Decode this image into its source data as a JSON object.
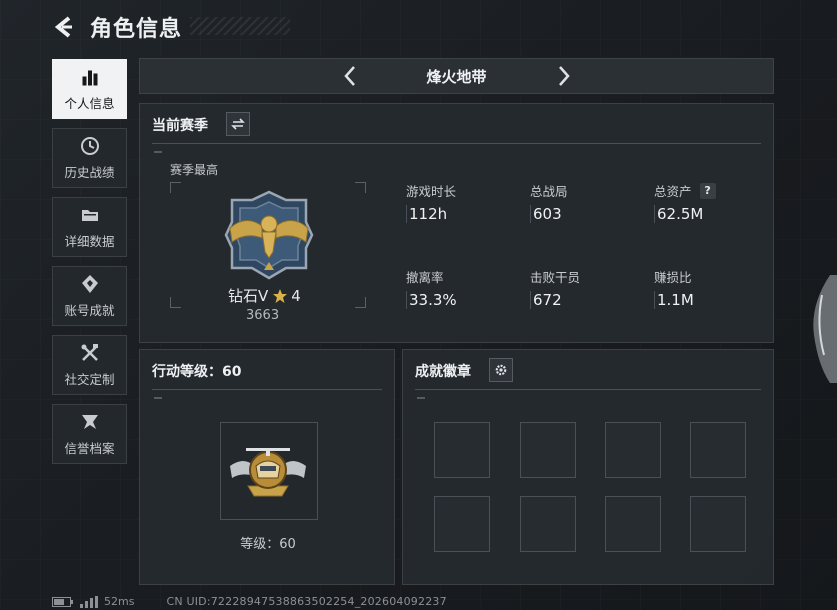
{
  "header": {
    "title": "角色信息"
  },
  "sidebar": {
    "items": [
      {
        "label": "个人信息",
        "icon": "bar-chart-icon",
        "active": true
      },
      {
        "label": "历史战绩",
        "icon": "history-icon"
      },
      {
        "label": "详细数据",
        "icon": "folder-icon"
      },
      {
        "label": "账号成就",
        "icon": "achievement-icon"
      },
      {
        "label": "社交定制",
        "icon": "tools-icon"
      },
      {
        "label": "信誉档案",
        "icon": "credit-icon"
      }
    ]
  },
  "mode_bar": {
    "name": "烽火地带"
  },
  "season": {
    "title": "当前赛季",
    "best_label": "赛季最高",
    "rank_name": "钻石V",
    "rank_stars": "4",
    "rank_score": "3663",
    "stats": [
      {
        "label": "游戏时长",
        "value": "112h"
      },
      {
        "label": "总战局",
        "value": "603"
      },
      {
        "label": "总资产",
        "value": "62.5M",
        "help": "?"
      },
      {
        "label": "撤离率",
        "value": "33.3%"
      },
      {
        "label": "击败干员",
        "value": "672"
      },
      {
        "label": "赚损比",
        "value": "1.1M"
      }
    ]
  },
  "action_level": {
    "title": "行动等级：60",
    "level_label": "等级：60"
  },
  "badges": {
    "title": "成就徽章",
    "slot_count": 8
  },
  "footer": {
    "latency": "52ms",
    "uid": "CN UID:72228947538863502254_202604092237"
  },
  "colors": {
    "panel": "#252a2f",
    "accent_gold": "#c9a34a",
    "active_tab": "#f0f2f3",
    "rank_blue": "#3d5a78"
  }
}
